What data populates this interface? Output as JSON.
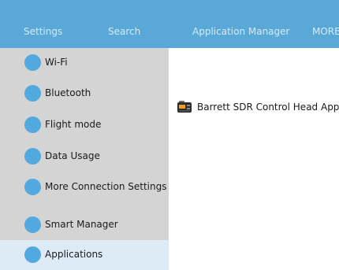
{
  "topbar": {
    "tabs": {
      "settings": "Settings",
      "search": "Search",
      "app_manager": "Application Manager",
      "more": "MORE"
    }
  },
  "sidebar": {
    "items": [
      {
        "label": "Wi-Fi"
      },
      {
        "label": "Bluetooth"
      },
      {
        "label": "Flight mode"
      },
      {
        "label": "Data Usage"
      },
      {
        "label": "More Connection Settings"
      },
      {
        "label": "Smart Manager"
      },
      {
        "label": "Applications",
        "selected": true
      }
    ]
  },
  "content": {
    "apps": [
      {
        "label": "Barrett SDR Control Head App",
        "icon": "radio-device-icon"
      }
    ]
  },
  "colors": {
    "topbar": "#5aa8d8",
    "sidebar": "#d4d4d4",
    "selected_item": "#dcebf5",
    "item_dot": "#52a9e0"
  }
}
